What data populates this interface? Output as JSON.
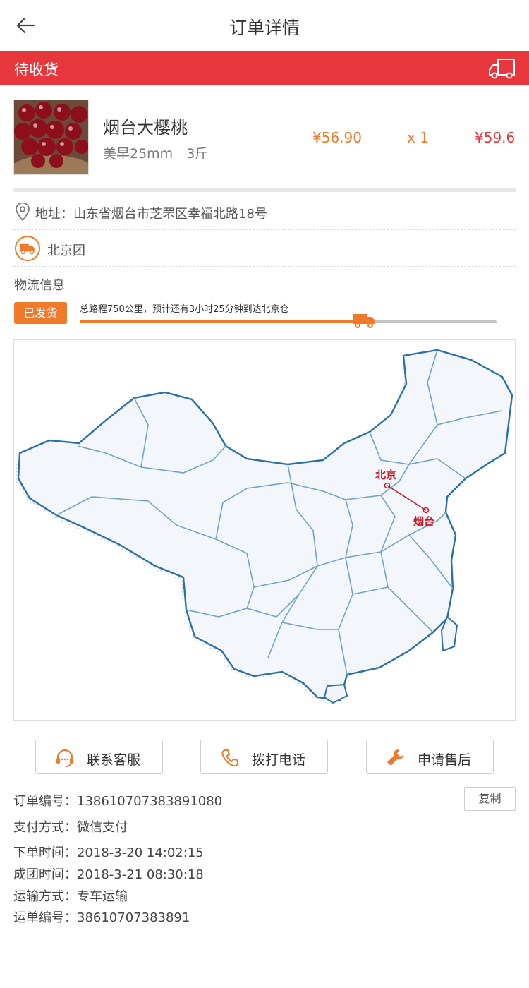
{
  "nav": {
    "title": "订单详情"
  },
  "status": {
    "label": "待收货"
  },
  "product": {
    "name": "烟台大樱桃",
    "spec": "美早25mm　3斤",
    "unit_price": "¥56.90",
    "qty": "x 1",
    "total": "¥59.6"
  },
  "address": {
    "text": "地址：山东省烟台市芝罘区幸福北路18号"
  },
  "group": {
    "text": "北京团"
  },
  "logistics": {
    "title": "物流信息",
    "badge": "已发货",
    "route_text": "总路程750公里，预计还有3小时25分钟到达北京仓",
    "progress": 0.68
  },
  "map": {
    "origin_label": "北京",
    "dest_label": "烟台"
  },
  "actions": {
    "service": "联系客服",
    "call": "拨打电话",
    "aftersale": "申请售后"
  },
  "order": {
    "number": "订单编号：13861070738389108​0",
    "copy": "复制",
    "payment": "支付方式：微信支付",
    "placed": "下单时间：2018-3-20  14:02:15",
    "grouped": "成团时间：2018-3-21  08:30:18",
    "shipping_method": "运输方式：专车运输",
    "waybill": "运单编号：38610707383891"
  },
  "colors": {
    "accent_red": "#e8373c",
    "accent_orange": "#f07a2a"
  }
}
